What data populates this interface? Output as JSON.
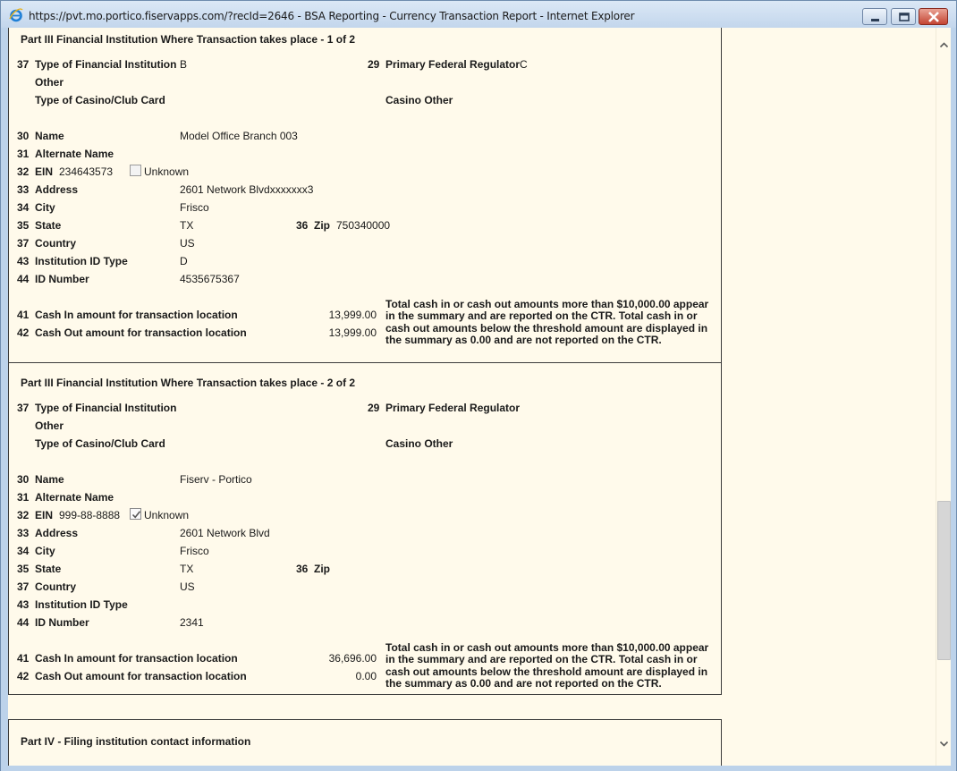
{
  "window": {
    "title": "https://pvt.mo.portico.fiservapps.com/?recId=2646 - BSA Reporting - Currency Transaction Report - Internet Explorer",
    "controls": {
      "minimize": "minimize",
      "maximize": "maximize",
      "close": "close"
    }
  },
  "labels": {
    "type_fin_inst_num": "37",
    "type_fin_inst": "Type of Financial Institution",
    "other": "Other",
    "casino_card": "Type of Casino/Club Card",
    "primary_reg_num": "29",
    "primary_reg": "Primary Federal Regulator",
    "casino_other": "Casino Other",
    "name_num": "30",
    "name": "Name",
    "alt_name_num": "31",
    "alt_name": "Alternate Name",
    "ein_num": "32",
    "ein": "EIN",
    "unknown": "Unknown",
    "address_num": "33",
    "address": "Address",
    "city_num": "34",
    "city": "City",
    "state_num": "35",
    "state": "State",
    "zip_num": "36",
    "zip": "Zip",
    "country_num": "37",
    "country": "Country",
    "inst_id_type_num": "43",
    "inst_id_type": "Institution ID Type",
    "id_number_num": "44",
    "id_number": "ID Number",
    "cash_in_num": "41",
    "cash_in": "Cash In amount for transaction location",
    "cash_out_num": "42",
    "cash_out": "Cash Out amount for transaction location",
    "threshold_note": "Total cash in or cash out amounts more than $10,000.00 appear in the summary and are reported on the CTR. Total cash in or cash out amounts below the threshold amount are displayed in the summary as 0.00 and are not reported on the CTR."
  },
  "sections": [
    {
      "heading": "Part III Financial Institution Where Transaction takes place - 1 of 2",
      "type_fin_inst": "B",
      "primary_reg": "C",
      "name": "Model Office Branch 003",
      "alt_name": "",
      "ein": "234643573",
      "ein_unknown": false,
      "address": "2601 Network Blvdxxxxxxx3",
      "city": "Frisco",
      "state": "TX",
      "zip": "750340000",
      "country": "US",
      "inst_id_type": "D",
      "id_number": "4535675367",
      "cash_in": "13,999.00",
      "cash_out": "13,999.00"
    },
    {
      "heading": "Part III Financial Institution Where Transaction takes place - 2 of 2",
      "type_fin_inst": "",
      "primary_reg": "",
      "name": "Fiserv - Portico",
      "alt_name": "",
      "ein": "999-88-8888",
      "ein_unknown": true,
      "address": "2601 Network Blvd",
      "city": "Frisco",
      "state": "TX",
      "zip": "",
      "country": "US",
      "inst_id_type": "",
      "id_number": "2341",
      "cash_in": "36,696.00",
      "cash_out": "0.00"
    }
  ],
  "part4": {
    "heading": "Part IV - Filing institution contact information"
  },
  "scrollbar": {
    "position_fraction": 0.68
  }
}
